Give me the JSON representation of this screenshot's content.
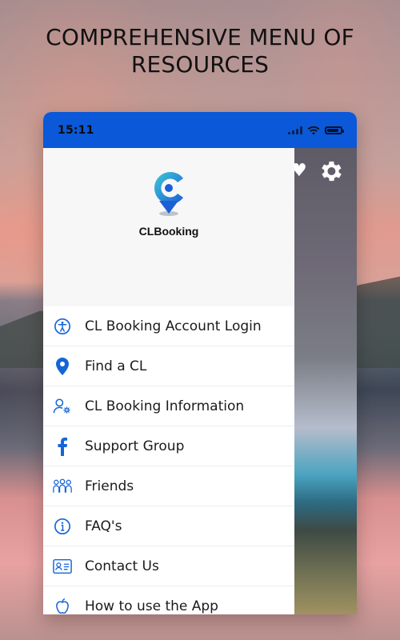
{
  "header": {
    "title": "COMPREHENSIVE MENU OF RESOURCES"
  },
  "status_bar": {
    "time": "15:11"
  },
  "drawer": {
    "brand_name": "CLBooking",
    "items": [
      {
        "label": "CL Booking Account Login",
        "icon": "accessibility-icon"
      },
      {
        "label": "Find a CL",
        "icon": "location-pin-icon"
      },
      {
        "label": "CL Booking Information",
        "icon": "user-settings-icon"
      },
      {
        "label": "Support Group",
        "icon": "facebook-icon"
      },
      {
        "label": "Friends",
        "icon": "friends-icon"
      },
      {
        "label": "FAQ's",
        "icon": "info-icon"
      },
      {
        "label": "Contact Us",
        "icon": "contact-card-icon"
      },
      {
        "label": "How to use the App",
        "icon": "apple-icon"
      }
    ]
  },
  "colors": {
    "status_bar": "#0b58d8",
    "icon_blue": "#1565d8"
  }
}
